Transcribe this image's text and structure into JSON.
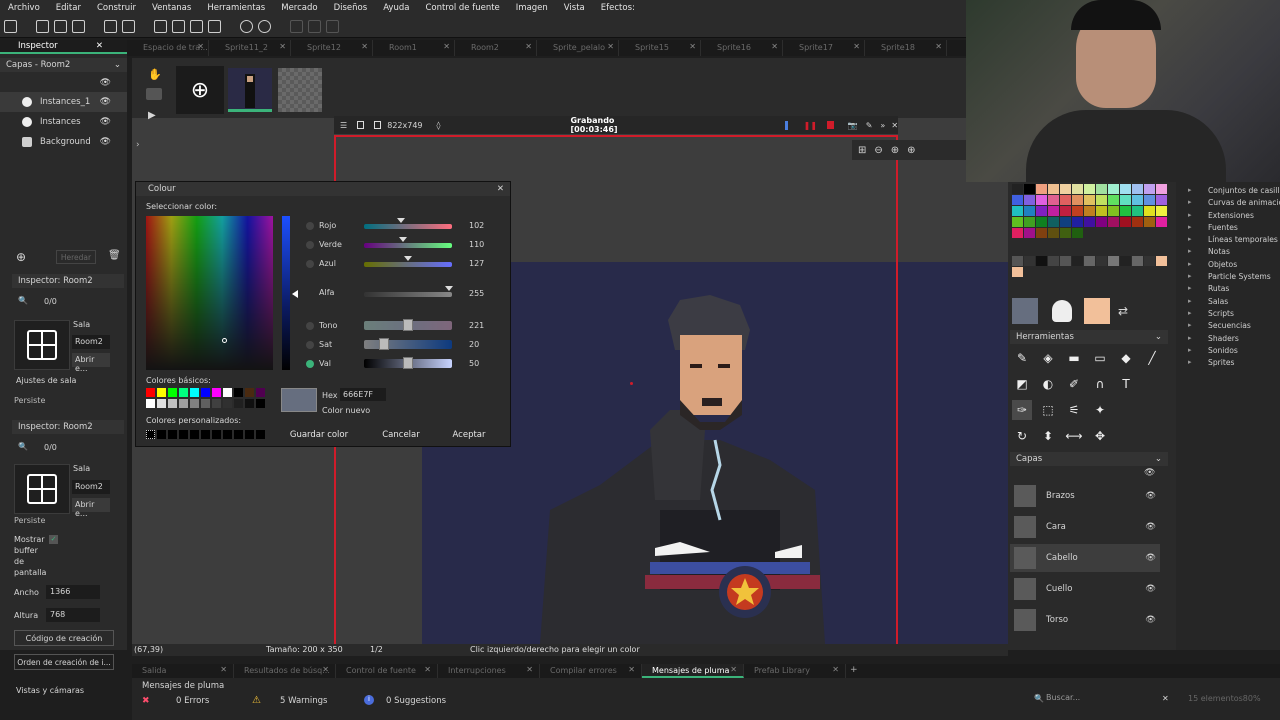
{
  "menu": [
    "Archivo",
    "Editar",
    "Construir",
    "Ventanas",
    "Herramientas",
    "Mercado",
    "Diseños",
    "Ayuda",
    "Control de fuente",
    "Imagen",
    "Vista",
    "Efectos:"
  ],
  "left": {
    "inspector_tab": "Inspector",
    "layers_head": "Capas - Room2",
    "layers": [
      "Instances_1",
      "Instances",
      "Background"
    ],
    "inherit_btn": "Heredar",
    "inspector1_head": "Inspector: Room2",
    "count1": "0/0",
    "room_type": "Sala",
    "room_name": "Room2",
    "open_btn": "Abrir e...",
    "room_settings": "Ajustes de sala",
    "persistent": "Persiste",
    "inspector2_head": "Inspector: Room2",
    "count2": "0/0",
    "room_type2": "Sala",
    "room_name2": "Room2",
    "open_btn2": "Abrir e...",
    "persistent2": "Persiste",
    "show_buffer": "Mostrar buffer de pantalla",
    "width_label": "Ancho",
    "width_value": "1366",
    "height_label": "Altura",
    "height_value": "768",
    "creation_code_btn": "Código de creación",
    "creation_order_btn": "Orden de creación de i...",
    "views_section": "Vistas y cámaras"
  },
  "tabs": [
    "Espacio de tra...",
    "Sprite11_2",
    "Sprite12",
    "Room1",
    "Room2",
    "Sprite_pelalo",
    "Sprite15",
    "Sprite16",
    "Sprite17",
    "Sprite18"
  ],
  "recorder": {
    "size": "822x749",
    "status": "Grabando [00:03:46]"
  },
  "colour_dialog": {
    "title": "Colour",
    "select_label": "Seleccionar color:",
    "red_label": "Rojo",
    "red_value": "102",
    "green_label": "Verde",
    "green_value": "110",
    "blue_label": "Azul",
    "blue_value": "127",
    "alpha_label": "Alfa",
    "alpha_value": "255",
    "hue_label": "Tono",
    "hue_value": "221",
    "sat_label": "Sat",
    "sat_value": "20",
    "val_label": "Val",
    "val_value": "50",
    "basic_colors_label": "Colores básicos:",
    "custom_colors_label": "Colores personalizados:",
    "hex_label": "Hex",
    "hex_value": "666E7F",
    "new_color_label": "Color nuevo",
    "save_btn": "Guardar color",
    "cancel_btn": "Cancelar",
    "accept_btn": "Aceptar",
    "current_color": "#666e7f"
  },
  "status": {
    "coords": "(67,39)",
    "size": "Tamaño: 200 x 350",
    "zoom": "1/2",
    "hint": "Clic izquierdo/derecho para elegir un color"
  },
  "right": {
    "tools_head": "Herramientas",
    "layers_head": "Capas",
    "layers": [
      "Brazos",
      "Cara",
      "Cabello",
      "Cuello",
      "Torso"
    ],
    "selected_layer": "Cabello"
  },
  "resource_tree": [
    "Conjuntos de casillas",
    "Curvas de animación",
    "Extensiones",
    "Fuentes",
    "Líneas temporales",
    "Notas",
    "Objetos",
    "Particle Systems",
    "Rutas",
    "Salas",
    "Scripts",
    "Secuencias",
    "Shaders",
    "Sonidos",
    "Sprites"
  ],
  "bottom_tabs": [
    "Salida",
    "Resultados de búsq...",
    "Control de fuente",
    "Interrupciones",
    "Compilar errores",
    "Mensajes de pluma",
    "Prefab Library"
  ],
  "active_bottom_tab": "Mensajes de pluma",
  "messages": {
    "title": "Mensajes de pluma",
    "errors": "0 Errors",
    "warnings": "5 Warnings",
    "suggestions": "0 Suggestions",
    "search_placeholder": "Buscar...",
    "elements": "15 elementos80%"
  },
  "colors": {
    "accent": "#3bb37a",
    "record_red": "#d01c2a",
    "artboard": "#282a4a"
  }
}
